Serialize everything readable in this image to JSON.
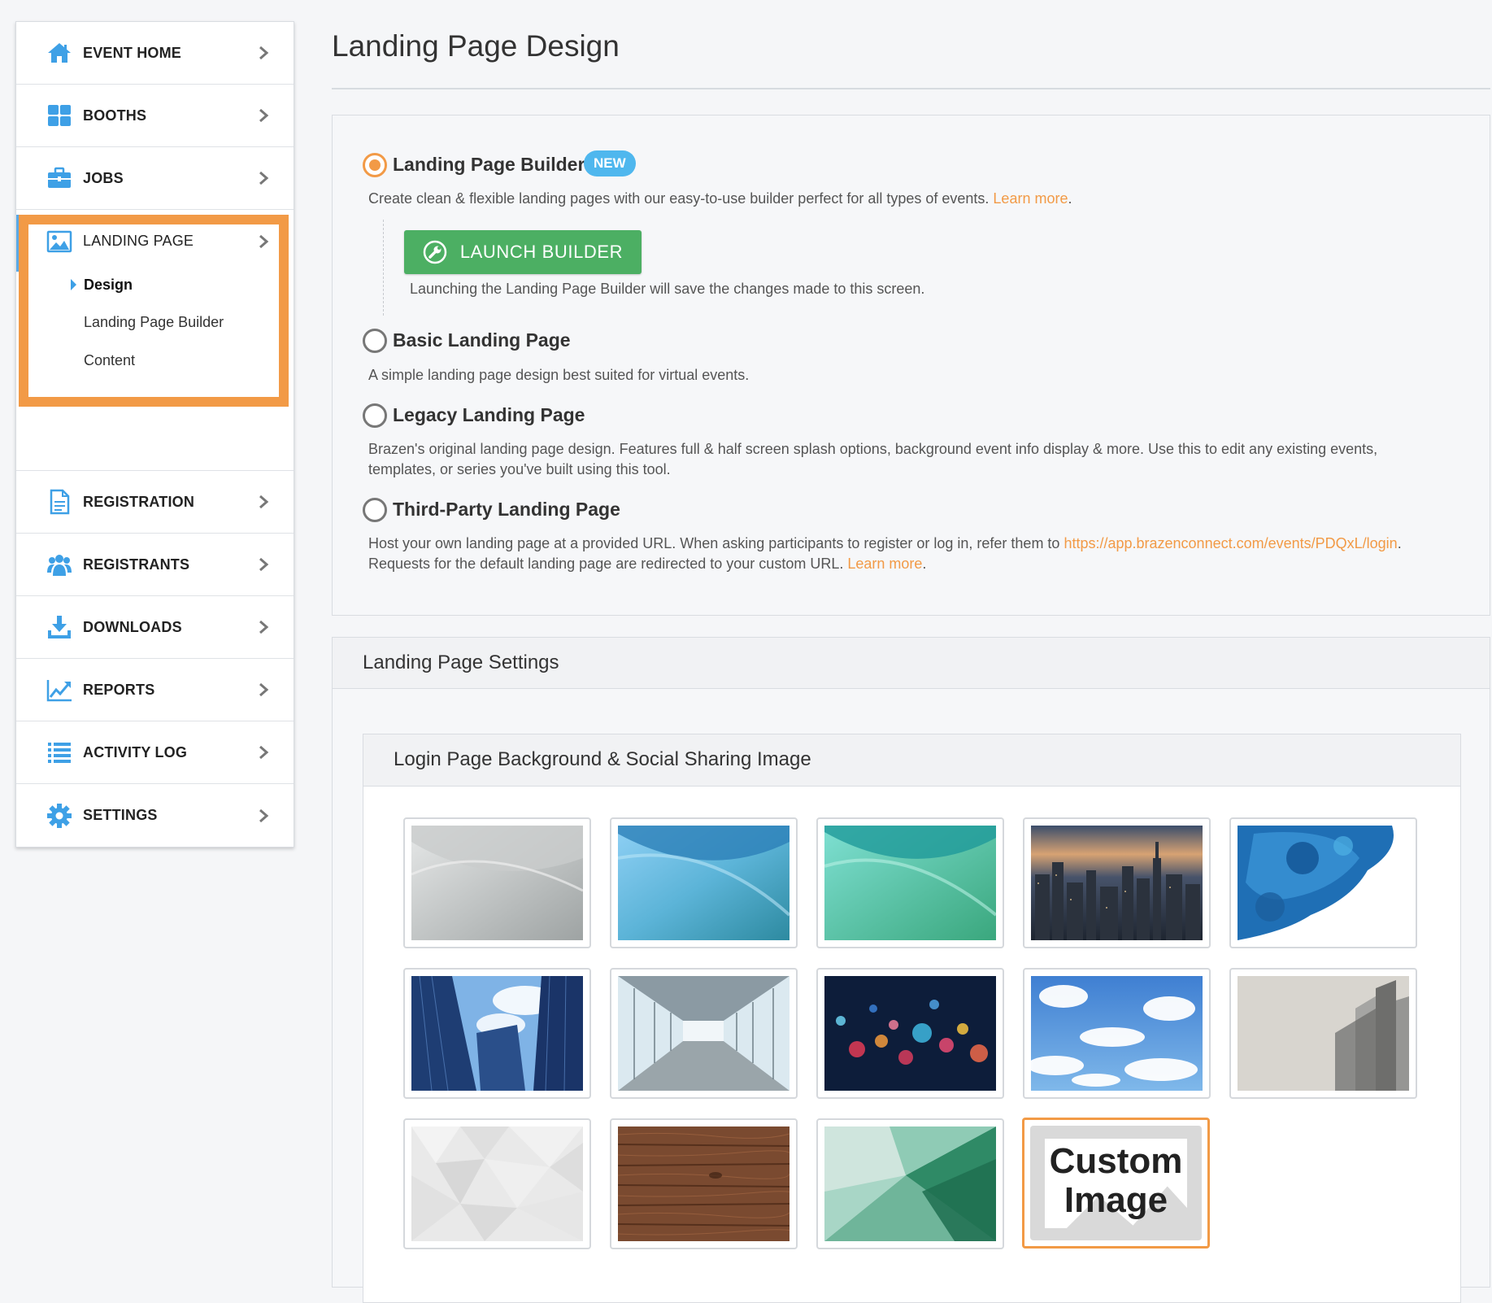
{
  "sidebar": {
    "items": [
      {
        "label": "EVENT HOME",
        "icon": "home-icon"
      },
      {
        "label": "BOOTHS",
        "icon": "grid-icon"
      },
      {
        "label": "JOBS",
        "icon": "briefcase-icon"
      },
      {
        "label": "LANDING PAGE",
        "icon": "image-icon"
      },
      {
        "label": "REGISTRATION",
        "icon": "document-icon"
      },
      {
        "label": "REGISTRANTS",
        "icon": "users-icon"
      },
      {
        "label": "DOWNLOADS",
        "icon": "download-icon"
      },
      {
        "label": "REPORTS",
        "icon": "chart-icon"
      },
      {
        "label": "ACTIVITY LOG",
        "icon": "list-icon"
      },
      {
        "label": "SETTINGS",
        "icon": "gear-icon"
      }
    ],
    "landing_sub": [
      "Design",
      "Landing Page Builder",
      "Content"
    ],
    "active_sub": "Design"
  },
  "page": {
    "title": "Landing Page Design"
  },
  "options": {
    "builder": {
      "title": "Landing Page Builder",
      "badge": "NEW",
      "desc": "Create clean & flexible landing pages with our easy-to-use builder perfect for all types of events. ",
      "learn_more": "Learn more",
      "period": ".",
      "button": "LAUNCH BUILDER",
      "note": "Launching the Landing Page Builder will save the changes made to this screen.",
      "selected": true
    },
    "basic": {
      "title": "Basic Landing Page",
      "desc": "A simple landing page design best suited for virtual events."
    },
    "legacy": {
      "title": "Legacy Landing Page",
      "desc_line1": "Brazen's original landing page design. Features full & half screen splash options, background event info display & more. Use this to edit any existing events,",
      "desc_line2": "templates, or series you've built using this tool."
    },
    "third_party": {
      "title": "Third-Party Landing Page",
      "desc_pre": "Host your own landing page at a provided URL. When asking participants to register or log in, refer them to ",
      "url": "https://app.brazenconnect.com/events/PDQxL/login",
      "desc_post": ".",
      "desc_line2": "Requests for the default landing page are redirected to your custom URL. ",
      "learn_more": "Learn more",
      "period": "."
    }
  },
  "settings": {
    "title": "Landing Page Settings",
    "sub_title": "Login Page Background & Social Sharing Image",
    "custom_label_1": "Custom",
    "custom_label_2": "Image",
    "selected_image": "custom"
  },
  "colors": {
    "accent_orange": "#f29a46",
    "link_blue": "#4fb7ee",
    "button_green": "#4caf63",
    "icon_blue": "#3ea0e6"
  }
}
